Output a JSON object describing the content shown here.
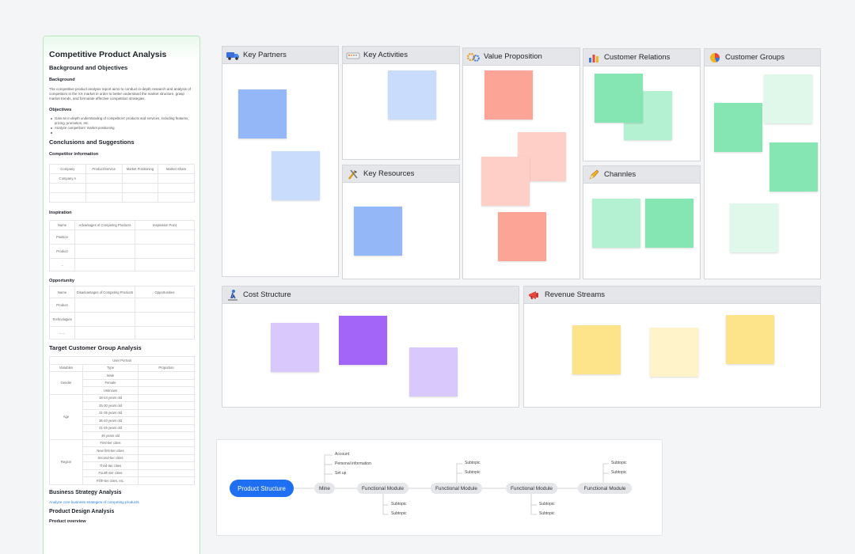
{
  "doc": {
    "title": "Competitive Product Analysis",
    "background_objectives": "Background and Objectives",
    "background_label": "Background",
    "background_text": "The competitive product analysis report aims to conduct in-depth research and analysis of competitors in the XX market in order to better understand the market structure, grasp market trends, and formulate effective competition strategies.",
    "objectives_label": "Objectives",
    "objectives": [
      "Gain an in-depth understanding of competitors' products and services, including features, pricing, promotion, etc.",
      "Analyze competitors' market positioning",
      "",
      ""
    ],
    "conclusions": "Conclusions and Suggestions",
    "competitor_info": "Competitor information",
    "competitor_table": {
      "headers": [
        "Company",
        "Product/Service",
        "Market Positioning",
        "Market Share"
      ],
      "rows": [
        [
          "Company A",
          "",
          "",
          ""
        ],
        [
          "",
          "",
          "",
          ""
        ],
        [
          "",
          "",
          "",
          ""
        ]
      ]
    },
    "inspiration": "Inspiration",
    "inspiration_table": {
      "headers": [
        "Name",
        "Advantages of Competing Products",
        "Inspiration Point"
      ],
      "rows": [
        [
          "Position",
          "",
          ""
        ],
        [
          "Product",
          "",
          ""
        ],
        [
          "...",
          "",
          ""
        ]
      ]
    },
    "opportunity": "Opportunity",
    "opportunity_table": {
      "headers": [
        "Name",
        "Disadvantages of Competing Products",
        "Opportunities"
      ],
      "rows": [
        [
          "Product",
          "",
          ""
        ],
        [
          "Technologies",
          "",
          ""
        ],
        [
          "......",
          "",
          ""
        ]
      ]
    },
    "target_customer": "Target Customer Group Analysis",
    "user_portrait": "User Portrait",
    "customer_headers": [
      "Variables",
      "Type",
      "Proportion"
    ],
    "gender_label": "Gender",
    "gender_types": [
      "Male",
      "Female",
      "Unknown"
    ],
    "age_label": "Age",
    "age_types": [
      "18-24 years old",
      "25-30 years old",
      "31-35 years old",
      "36-40 years old",
      "41-45 years old",
      "46 years old"
    ],
    "region_label": "Region",
    "region_types": [
      "First-tier cities",
      "New first-tier cities",
      "Second-tier cities",
      "Third-tier cities",
      "Fourth-tier cities",
      "Fifth-tier cities, etc."
    ],
    "business_strategy": "Business Strategy Analysis",
    "business_link": "Analyze core business strategies of competing products",
    "product_design": "Product Design Analysis",
    "product_overview": "Product overview"
  },
  "canvas": {
    "key_partners": "Key Partners",
    "key_activities": "Key Activities",
    "key_resources": "Key Resources",
    "value_proposition": "Value Proposition",
    "customer_relations": "Customer Relations",
    "channels": "Channles",
    "customer_groups": "Customer Groups",
    "cost_structure": "Cost Structure",
    "revenue_streams": "Revenue Streams"
  },
  "colors": {
    "blue": "#94b7f7",
    "light_blue": "#c9dcfb",
    "salmon": "#fca596",
    "light_salmon": "#fdcfc7",
    "green": "#85e6b4",
    "light_green": "#b4f1d3",
    "pale_green": "#dff8ea",
    "lavender": "#d8c8fc",
    "purple": "#a364f8",
    "yellow": "#fde48a",
    "light_yellow": "#fef3c9"
  },
  "mindmap": {
    "root": "Product Structure",
    "mine": "Mine",
    "mine_leaves": [
      "Account",
      "Personal information",
      "Set up"
    ],
    "modules": [
      "Functional Module",
      "Functional Module",
      "Functional Module",
      "Functional Module"
    ],
    "subtopic": "Subtopic"
  }
}
